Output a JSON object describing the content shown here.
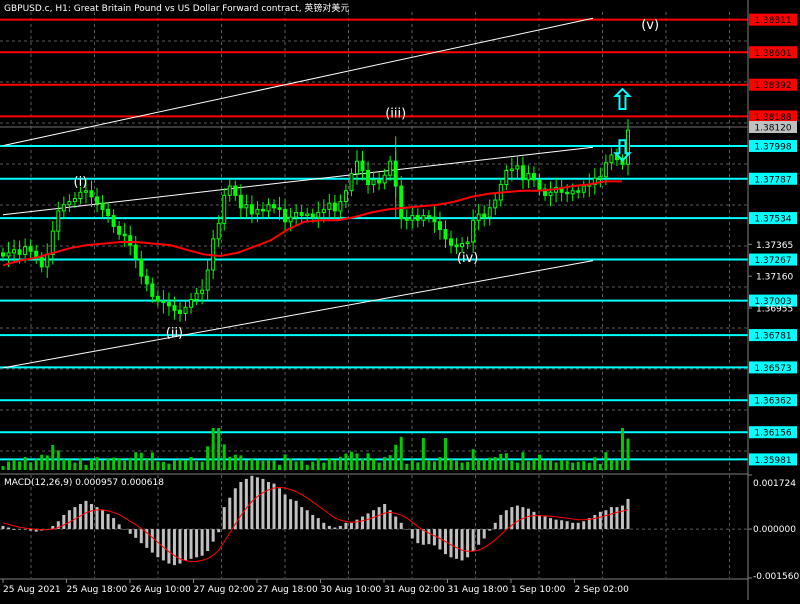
{
  "header": {
    "title": "GBPUSD.c, H1:  Great Britain Pound vs US Dollar Forward contract, 英镑对美元"
  },
  "colors": {
    "background": "#000000",
    "grid": "#5a5a5a",
    "candle": "#00ff00",
    "resistance": "#ff0000",
    "support": "#00ffff",
    "channel": "#ffffff",
    "ma": "#ff0000",
    "volume": "#00cc00",
    "macd_hist": "#c0c0c0",
    "macd_signal": "#ff0000"
  },
  "chart_data": [
    {
      "type": "candlestick",
      "symbol": "GBPUSD.c",
      "timeframe": "H1",
      "ylim": [
        1.359,
        1.3886
      ],
      "y_ticks": [
        "1.37365",
        "1.37160",
        "1.36955"
      ],
      "x_ticks": [
        "25 Aug 2021",
        "25 Aug 18:00",
        "26 Aug 10:00",
        "27 Aug 02:00",
        "27 Aug 18:00",
        "30 Aug 10:00",
        "31 Aug 02:00",
        "31 Aug 18:00",
        "1 Sep 10:00",
        "2 Sep 02:00"
      ],
      "current_price": "1.38120",
      "resistance_levels": [
        {
          "price": 1.38811,
          "label": "1.38811"
        },
        {
          "price": 1.38601,
          "label": "1.38601"
        },
        {
          "price": 1.38392,
          "label": "1.38392"
        },
        {
          "price": 1.38188,
          "label": "1.38188"
        }
      ],
      "support_levels": [
        {
          "price": 1.37998,
          "label": "1.37998"
        },
        {
          "price": 1.37787,
          "label": "1.37787"
        },
        {
          "price": 1.37534,
          "label": "1.37534"
        },
        {
          "price": 1.37267,
          "label": "1.37267"
        },
        {
          "price": 1.37003,
          "label": "1.37003"
        },
        {
          "price": 1.36781,
          "label": "1.36781"
        },
        {
          "price": 1.36573,
          "label": "1.36573"
        },
        {
          "price": 1.36362,
          "label": "1.36362"
        },
        {
          "price": 1.36156,
          "label": "1.36156"
        },
        {
          "price": 1.35981,
          "label": "1.35981"
        }
      ],
      "wave_labels": [
        {
          "label": "(i)",
          "bar": 14,
          "price": 1.3774
        },
        {
          "label": "(ii)",
          "bar": 31,
          "price": 1.3677
        },
        {
          "label": "(iii)",
          "bar": 71,
          "price": 1.3818
        },
        {
          "label": "(iv)",
          "bar": 84,
          "price": 1.3725
        },
        {
          "label": "(v)",
          "bar": 117,
          "price": 1.3875
        }
      ],
      "arrows": [
        {
          "direction": "up",
          "bar": 112,
          "price": 1.383
        },
        {
          "direction": "down",
          "bar": 112,
          "price": 1.3797
        }
      ],
      "closes": [
        1.3729,
        1.3731,
        1.3733,
        1.373,
        1.3735,
        1.3732,
        1.3728,
        1.3722,
        1.373,
        1.3745,
        1.3758,
        1.3762,
        1.3764,
        1.3766,
        1.377,
        1.3771,
        1.3767,
        1.3763,
        1.3759,
        1.3755,
        1.3748,
        1.3743,
        1.3742,
        1.3736,
        1.3727,
        1.3716,
        1.3711,
        1.3703,
        1.37,
        1.3699,
        1.3697,
        1.3694,
        1.3692,
        1.3696,
        1.3701,
        1.3705,
        1.3707,
        1.372,
        1.374,
        1.375,
        1.3768,
        1.3774,
        1.3768,
        1.376,
        1.3762,
        1.3756,
        1.3759,
        1.3758,
        1.3762,
        1.376,
        1.3759,
        1.3751,
        1.3754,
        1.3757,
        1.3755,
        1.3756,
        1.3754,
        1.3757,
        1.3759,
        1.3763,
        1.3758,
        1.3764,
        1.3771,
        1.3782,
        1.379,
        1.3784,
        1.3775,
        1.3778,
        1.3776,
        1.3781,
        1.379,
        1.3774,
        1.3753,
        1.3752,
        1.3755,
        1.3752,
        1.3755,
        1.3754,
        1.3751,
        1.3746,
        1.374,
        1.3736,
        1.3735,
        1.3737,
        1.3738,
        1.3752,
        1.3756,
        1.3754,
        1.376,
        1.3765,
        1.3775,
        1.3784,
        1.3785,
        1.3787,
        1.3778,
        1.3782,
        1.3778,
        1.3772,
        1.3768,
        1.377,
        1.3773,
        1.377,
        1.3769,
        1.3771,
        1.377,
        1.3774,
        1.3775,
        1.3779,
        1.378,
        1.3789,
        1.3794,
        1.3791,
        1.3788,
        1.381
      ],
      "ma": [
        1.3723,
        1.3726,
        1.3728,
        1.3731,
        1.3734,
        1.3736,
        1.3737,
        1.3738,
        1.3738,
        1.3737,
        1.3736,
        1.3733,
        1.373,
        1.3729,
        1.3731,
        1.3735,
        1.3739,
        1.3746,
        1.3751,
        1.3752,
        1.3752,
        1.3754,
        1.3757,
        1.3759,
        1.376,
        1.3761,
        1.3762,
        1.3764,
        1.3767,
        1.3769,
        1.377,
        1.3771,
        1.3771,
        1.3772,
        1.3774,
        1.3775,
        1.3777,
        1.3777
      ],
      "macd_ylim": [
        -0.00156,
        0.001724
      ],
      "macd_ticks": [
        "0.001724",
        "0.000000",
        "-0.001560"
      ],
      "macd_label": "MACD(12,26,9) 0.000957 0.000618",
      "macd_hist": [
        0.0001,
        5e-05,
        -3e-05,
        0.0,
        0.0,
        -5e-05,
        -8e-05,
        -5e-05,
        -2e-05,
        0.0001,
        0.00025,
        0.00045,
        0.0006,
        0.0007,
        0.0008,
        0.0009,
        0.0008,
        0.0007,
        0.0006,
        0.00048,
        0.00035,
        0.00015,
        0.0,
        -0.00015,
        -0.00028,
        -0.00045,
        -0.0006,
        -0.00075,
        -0.0009,
        -0.001,
        -0.0011,
        -0.00115,
        -0.0011,
        -0.001,
        -0.00095,
        -0.0009,
        -0.00085,
        -0.0007,
        -0.0004,
        -0.0001,
        0.0007,
        0.001,
        0.0013,
        0.0015,
        0.0016,
        0.0017,
        0.00165,
        0.0016,
        0.0015,
        0.00145,
        0.0013,
        0.0011,
        0.00095,
        0.0009,
        0.0007,
        0.0006,
        0.00045,
        0.00035,
        0.0002,
        0.0001,
        5e-05,
        0.0001,
        0.0002,
        0.0002,
        0.0003,
        0.0004,
        0.0005,
        0.0006,
        0.0007,
        0.0008,
        0.0006,
        0.0004,
        0.0002,
        0.0,
        -0.0003,
        -0.00045,
        -0.0005,
        -0.00048,
        -0.00052,
        -0.00065,
        -0.0008,
        -0.0009,
        -0.00095,
        -0.001,
        -0.0009,
        -0.0007,
        -0.0005,
        -0.0003,
        -5e-05,
        0.0002,
        0.00045,
        0.0006,
        0.0007,
        0.00075,
        0.0007,
        0.00065,
        0.00055,
        0.00045,
        0.0004,
        0.00035,
        0.0003,
        0.00028,
        0.00025,
        0.0002,
        0.0002,
        0.00025,
        0.00035,
        0.00045,
        0.00055,
        0.0006,
        0.0007,
        0.0007,
        0.00075,
        0.00096
      ],
      "macd_signal": [
        0.0002,
        0.00015,
        0.0001,
        6e-05,
        3e-05,
        1e-05,
        -1e-05,
        -2e-05,
        -2e-05,
        0.0,
        5e-05,
        0.00013,
        0.00022,
        0.00032,
        0.00042,
        0.00052,
        0.00058,
        0.00061,
        0.00061,
        0.00058,
        0.00053,
        0.00046,
        0.00036,
        0.00025,
        0.00014,
        2e-05,
        -0.00012,
        -0.00027,
        -0.00042,
        -0.00058,
        -0.00072,
        -0.00085,
        -0.00095,
        -0.00101,
        -0.00104,
        -0.00103,
        -0.001,
        -0.00094,
        -0.00083,
        -0.00068,
        -0.0004,
        -0.00012,
        0.00016,
        0.00043,
        0.00067,
        0.00088,
        0.00104,
        0.00116,
        0.00125,
        0.00131,
        0.00133,
        0.00131,
        0.00126,
        0.00119,
        0.0011,
        0.00099,
        0.00087,
        0.00074,
        0.00061,
        0.00048,
        0.00036,
        0.00028,
        0.00024,
        0.00022,
        0.00023,
        0.00026,
        0.00031,
        0.00037,
        0.00044,
        0.00051,
        0.00053,
        0.0005,
        0.00044,
        0.00035,
        0.00022,
        8e-05,
        -4e-05,
        -0.00013,
        -0.00021,
        -0.0003,
        -0.0004,
        -0.0005,
        -0.00059,
        -0.00067,
        -0.00071,
        -0.00071,
        -0.00067,
        -0.00059,
        -0.00048,
        -0.00034,
        -0.00018,
        -2e-05,
        0.00012,
        0.00025,
        0.00034,
        0.0004,
        0.00043,
        0.00043,
        0.00042,
        0.00041,
        0.00039,
        0.00037,
        0.00035,
        0.00032,
        0.0003,
        0.0003,
        0.00031,
        0.00034,
        0.00038,
        0.00043,
        0.00048,
        0.00053,
        0.00057,
        0.00062
      ]
    }
  ]
}
